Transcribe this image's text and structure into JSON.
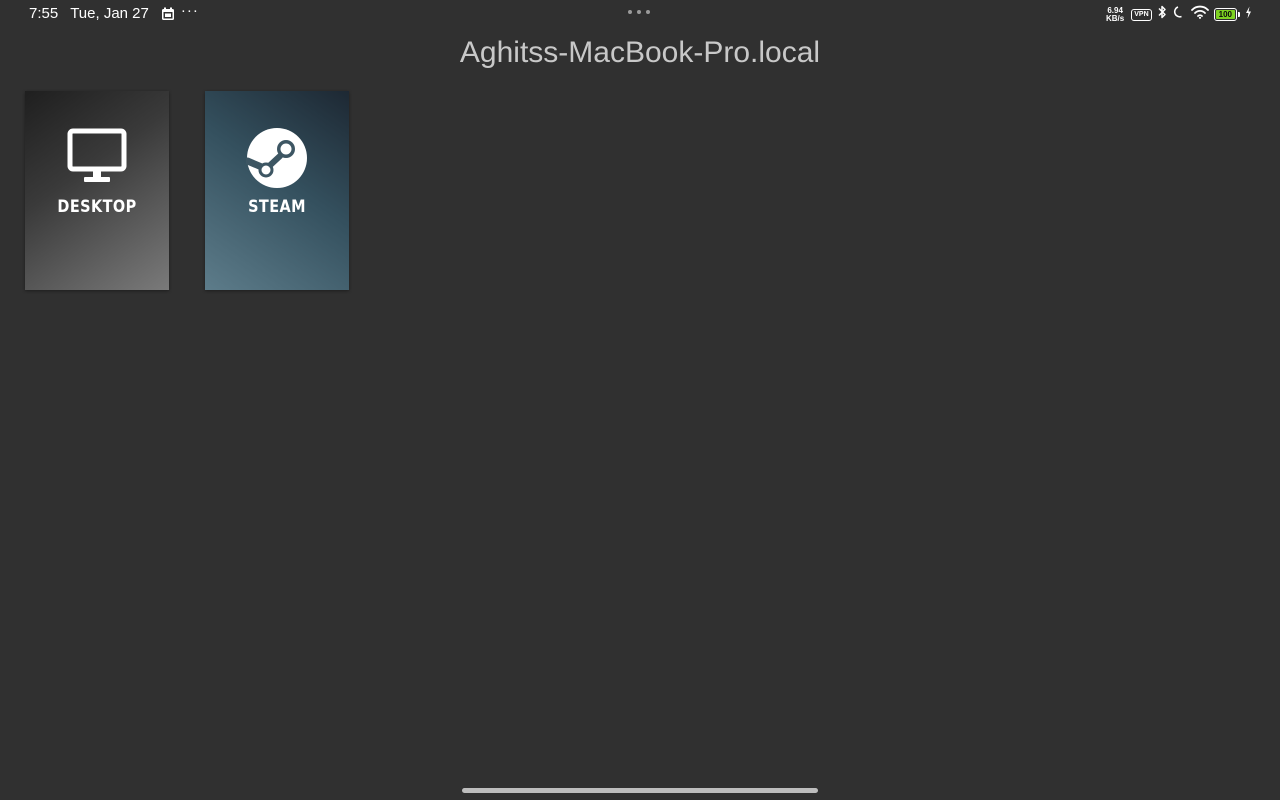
{
  "status_bar": {
    "time": "7:55",
    "date": "Tue, Jan 27",
    "more": "···",
    "net_speed_value": "6.94",
    "net_speed_unit": "KB/s",
    "vpn_label": "VPN",
    "battery_level": "100",
    "battery_color": "#7ed321"
  },
  "host": {
    "title": "Aghitss-MacBook-Pro.local"
  },
  "apps": [
    {
      "label": "DESKTOP",
      "icon": "monitor-icon"
    },
    {
      "label": "STEAM",
      "icon": "steam-icon"
    }
  ],
  "colors": {
    "background": "#303030",
    "title_text": "#c8c8c8"
  }
}
